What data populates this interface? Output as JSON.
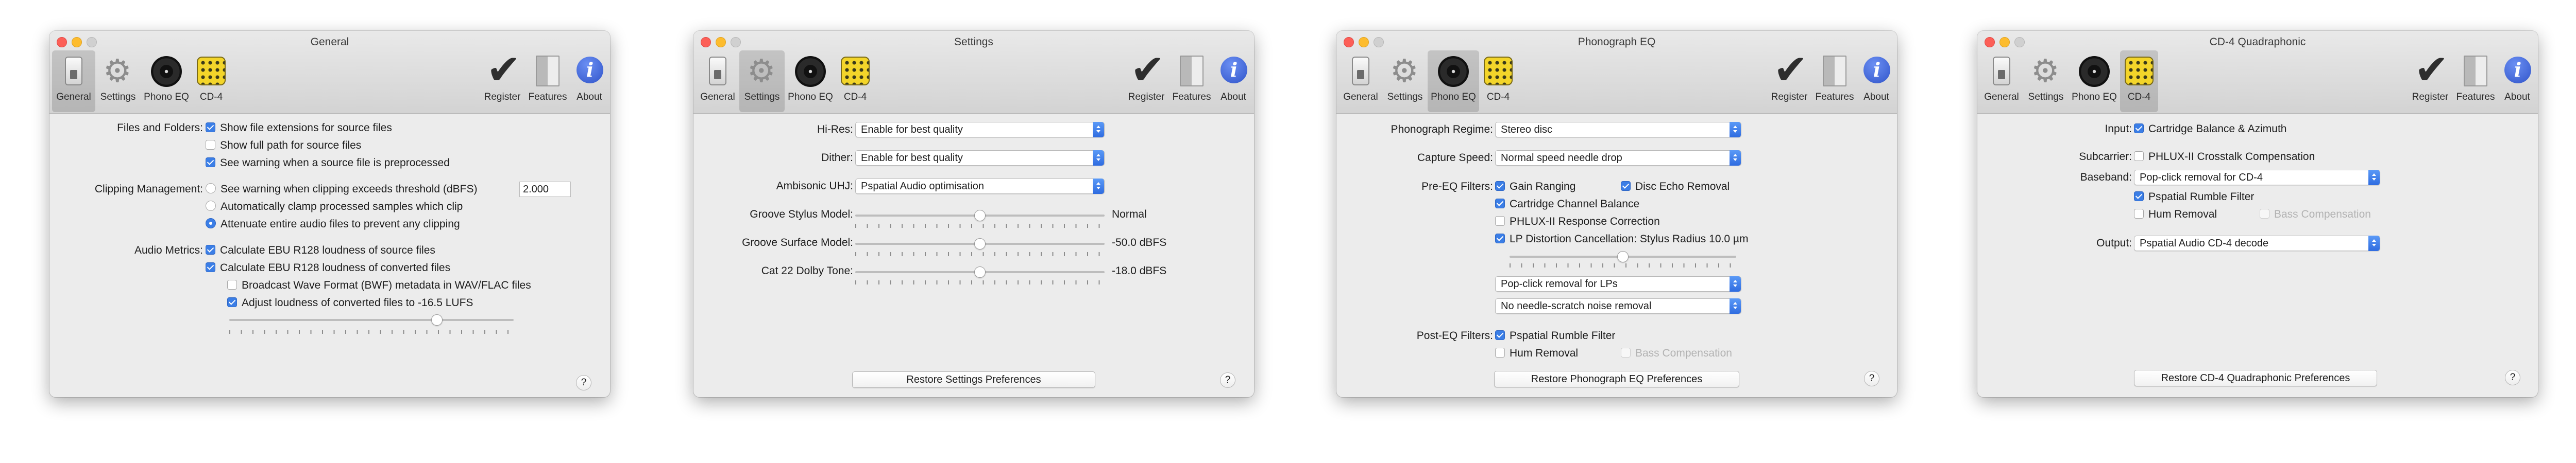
{
  "toolbar": {
    "general": "General",
    "settings": "Settings",
    "phono_eq": "Phono EQ",
    "cd4": "CD-4",
    "register": "Register",
    "features": "Features",
    "about": "About"
  },
  "icons": {
    "general": "device-icon",
    "settings": "gear-icon",
    "phono_eq": "record-icon",
    "cd4": "quad-disc-icon",
    "register": "checkmark-icon",
    "features": "book-icon",
    "about": "info-icon"
  },
  "colors": {
    "accent": "#3b7ee6",
    "close": "#fc5f57",
    "minimize": "#fdbc2e"
  },
  "general": {
    "title": "General",
    "files_label": "Files and Folders:",
    "show_ext": "Show file extensions for source files",
    "show_full_path": "Show full path for source files",
    "see_warning_pre": "See warning when a source file is preprocessed",
    "clip_label": "Clipping Management:",
    "clip_warn": "See warning when clipping exceeds threshold (dBFS)",
    "clip_threshold": "2.000",
    "clip_clamp": "Automatically clamp processed samples which clip",
    "clip_attenuate": "Attenuate entire audio files to prevent any clipping",
    "metrics_label": "Audio Metrics:",
    "calc_source": "Calculate EBU R128 loudness of source files",
    "calc_converted": "Calculate EBU R128 loudness of converted files",
    "bwf": "Broadcast Wave Format (BWF) metadata in WAV/FLAC files",
    "adjust": "Adjust loudness of converted files to -16.5 LUFS",
    "loudness_slider_position": 0.73,
    "help": "?"
  },
  "settings": {
    "title": "Settings",
    "hires_label": "Hi-Res:",
    "hires_value": "Enable for best quality",
    "dither_label": "Dither:",
    "dither_value": "Enable for best quality",
    "ambisonic_label": "Ambisonic UHJ:",
    "ambisonic_value": "Pspatial Audio optimisation",
    "stylus_label": "Groove Stylus Model:",
    "stylus_value": "Normal",
    "stylus_position": 0.5,
    "surface_label": "Groove Surface Model:",
    "surface_value": "-50.0 dBFS",
    "surface_position": 0.5,
    "dolby_label": "Cat 22 Dolby Tone:",
    "dolby_value": "-18.0 dBFS",
    "dolby_position": 0.5,
    "restore": "Restore Settings Preferences",
    "help": "?"
  },
  "phono": {
    "title": "Phonograph EQ",
    "regime_label": "Phonograph Regime:",
    "regime_value": "Stereo disc",
    "speed_label": "Capture Speed:",
    "speed_value": "Normal speed needle drop",
    "pre_label": "Pre-EQ Filters:",
    "gain_ranging": "Gain Ranging",
    "disc_echo": "Disc Echo Removal",
    "cartridge": "Cartridge Channel Balance",
    "phlux": "PHLUX-II Response Correction",
    "lp_distortion": "LP Distortion Cancellation: Stylus Radius 10.0 µm",
    "stylus_radius_position": 0.5,
    "pop_click": "Pop-click removal for LPs",
    "needle": "No needle-scratch noise removal",
    "post_label": "Post-EQ Filters:",
    "rumble": "Pspatial Rumble Filter",
    "hum": "Hum Removal",
    "bass": "Bass Compensation",
    "restore": "Restore Phonograph EQ Preferences",
    "help": "?"
  },
  "cd4": {
    "title": "CD-4 Quadraphonic",
    "input_label": "Input:",
    "input_value": "Cartridge Balance & Azimuth",
    "subcarrier_label": "Subcarrier:",
    "subcarrier_value": "PHLUX-II Crosstalk Compensation",
    "baseband_label": "Baseband:",
    "baseband_value": "Pop-click removal for CD-4",
    "rumble": "Pspatial Rumble Filter",
    "hum": "Hum Removal",
    "bass": "Bass Compensation",
    "output_label": "Output:",
    "output_value": "Pspatial Audio CD-4 decode",
    "restore": "Restore CD-4 Quadraphonic Preferences",
    "help": "?"
  }
}
